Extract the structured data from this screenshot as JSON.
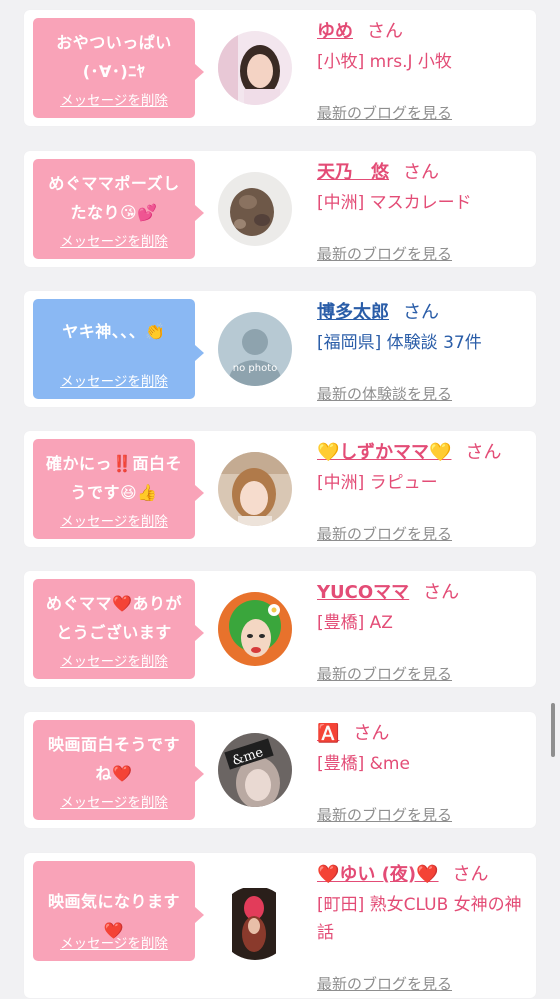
{
  "colors": {
    "pink_bubble": "#f9a3b8",
    "blue_bubble": "#8ab8f3",
    "name_pink": "#e34c76",
    "name_blue": "#2a5da8",
    "link_gray": "#8e8e8e"
  },
  "cards": [
    {
      "message": "おやついっぱい\n(･∀･)ﾆﾔ",
      "delete_label": "メッセージを削除",
      "name": "ゆめ",
      "suffix": "さん",
      "shop": "[小牧] mrs.J 小牧",
      "link": "最新のブログを見る"
    },
    {
      "message": "めぐママポーズし\nたなり😘💕",
      "delete_label": "メッセージを削除",
      "name": "天乃　悠",
      "suffix": "さん",
      "shop": "[中洲] マスカレード",
      "link": "最新のブログを見る"
    },
    {
      "message": "ヤキ神、、、👏",
      "delete_label": "メッセージを削除",
      "name": "博多太郎",
      "suffix": "さん",
      "shop": "[福岡県] 体験談 37件",
      "link": "最新の体験談を見る",
      "avatar_text": "no photo"
    },
    {
      "message": "確かにっ‼️面白そ\nうです😆👍",
      "delete_label": "メッセージを削除",
      "name": "💛しずかママ💛",
      "suffix": "さん",
      "shop": "[中洲] ラピュー",
      "link": "最新のブログを見る"
    },
    {
      "message": "めぐママ❤️ありが\nとうございます",
      "delete_label": "メッセージを削除",
      "name": "YUCOママ",
      "suffix": "さん",
      "shop": "[豊橋] AZ",
      "link": "最新のブログを見る"
    },
    {
      "message": "映画面白そうです\nね❤️",
      "delete_label": "メッセージを削除",
      "name": "🅰️",
      "suffix": "さん",
      "shop": "[豊橋] &me",
      "link": "最新のブログを見る",
      "avatar_text": "&me"
    },
    {
      "message": "映画気になります\n❤️",
      "delete_label": "メッセージを削除",
      "name": "❤️ゆい (夜)❤️",
      "suffix": "さん",
      "shop": "[町田] 熟女CLUB 女神の神話",
      "link": "最新のブログを見る"
    }
  ]
}
